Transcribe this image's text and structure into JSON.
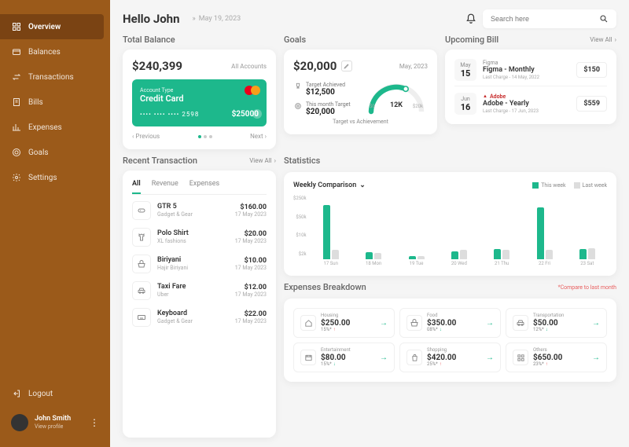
{
  "sidebar": {
    "items": [
      {
        "label": "Overview",
        "icon": "grid-icon"
      },
      {
        "label": "Balances",
        "icon": "wallet-icon"
      },
      {
        "label": "Transactions",
        "icon": "transfer-icon"
      },
      {
        "label": "Bills",
        "icon": "bill-icon"
      },
      {
        "label": "Expenses",
        "icon": "chart-icon"
      },
      {
        "label": "Goals",
        "icon": "target-icon"
      },
      {
        "label": "Settings",
        "icon": "gear-icon"
      }
    ],
    "logout": "Logout",
    "profile": {
      "name": "John Smith",
      "sub": "View profile"
    }
  },
  "header": {
    "hello": "Hello John",
    "date": "May 19, 2023",
    "search_placeholder": "Search here"
  },
  "total_balance": {
    "title": "Total Balance",
    "amount": "$240,399",
    "all_accounts": "All Accounts",
    "card": {
      "acc_label": "Account Type",
      "type": "Credit Card",
      "number": "•••• •••• •••• 2598",
      "balance": "$25000"
    },
    "prev": "Previous",
    "next": "Next"
  },
  "goals": {
    "title": "Goals",
    "amount": "$20,000",
    "month": "May, 2023",
    "achieved_label": "Target Achieved",
    "achieved": "$12,500",
    "target_label": "This month Target",
    "target": "$20,000",
    "gauge": {
      "min": "$0",
      "max": "$20k",
      "val": "12K"
    },
    "footer": "Target vs Achievement"
  },
  "bills": {
    "title": "Upcoming Bill",
    "viewall": "View All",
    "items": [
      {
        "month": "May",
        "day": "15",
        "vendor": "Figma",
        "name": "Figma - Monthly",
        "sub": "Last Charge - 14 May, 2022",
        "amount": "$150"
      },
      {
        "month": "Jun",
        "day": "16",
        "vendor": "Adobe",
        "name": "Adobe - Yearly",
        "sub": "Last Charge - 17 Jun, 2023",
        "amount": "$559"
      }
    ]
  },
  "recent": {
    "title": "Recent Transaction",
    "viewall": "View All",
    "tabs": [
      "All",
      "Revenue",
      "Expenses"
    ],
    "items": [
      {
        "name": "GTR 5",
        "sub": "Gadget & Gear",
        "amount": "$160.00",
        "date": "17 May 2023",
        "icon": "gamepad-icon"
      },
      {
        "name": "Polo Shirt",
        "sub": "XL fashions",
        "amount": "$20.00",
        "date": "17 May 2023",
        "icon": "shirt-icon"
      },
      {
        "name": "Biriyani",
        "sub": "Hajir Biriyani",
        "amount": "$10.00",
        "date": "17 May 2023",
        "icon": "food-icon"
      },
      {
        "name": "Taxi Fare",
        "sub": "Uber",
        "amount": "$12.00",
        "date": "17 May 2023",
        "icon": "car-icon"
      },
      {
        "name": "Keyboard",
        "sub": "Gadget & Gear",
        "amount": "$22.00",
        "date": "17 May 2023",
        "icon": "keyboard-icon"
      }
    ]
  },
  "stats": {
    "title": "Statistics",
    "dropdown": "Weekly Comparison",
    "legend": {
      "this": "This week",
      "last": "Last week"
    },
    "ylabels": [
      "$250k",
      "$50k",
      "$10k",
      "$2k"
    ],
    "xlabels": [
      "17 Sun",
      "18 Mon",
      "19 Tue",
      "20 Wed",
      "21 Thu",
      "22 Fri",
      "23 Sat"
    ]
  },
  "chart_data": {
    "type": "bar",
    "categories": [
      "17 Sun",
      "18 Mon",
      "19 Tue",
      "20 Wed",
      "21 Thu",
      "22 Fri",
      "23 Sat"
    ],
    "series": [
      {
        "name": "This week",
        "values": [
          240,
          30,
          8,
          35,
          45,
          230,
          45
        ]
      },
      {
        "name": "Last week",
        "values": [
          40,
          28,
          15,
          40,
          40,
          40,
          50
        ]
      }
    ],
    "title": "Weekly Comparison",
    "ylabel": "$",
    "ylim": [
      0,
      250
    ]
  },
  "expenses": {
    "title": "Expenses Breakdown",
    "note": "*Compare to last month",
    "items": [
      {
        "cat": "Housing",
        "val": "$250.00",
        "pct": "15%*",
        "dir": "up",
        "icon": "house-icon"
      },
      {
        "cat": "Food",
        "val": "$350.00",
        "pct": "08%*",
        "dir": "down",
        "icon": "food-icon"
      },
      {
        "cat": "Transportation",
        "val": "$50.00",
        "pct": "12%*",
        "dir": "down",
        "icon": "car-icon"
      },
      {
        "cat": "Entertainment",
        "val": "$80.00",
        "pct": "15%*",
        "dir": "down",
        "icon": "film-icon"
      },
      {
        "cat": "Shopping",
        "val": "$420.00",
        "pct": "25%*",
        "dir": "up",
        "icon": "bag-icon"
      },
      {
        "cat": "Others",
        "val": "$650.00",
        "pct": "23%*",
        "dir": "up",
        "icon": "grid-icon"
      }
    ]
  }
}
